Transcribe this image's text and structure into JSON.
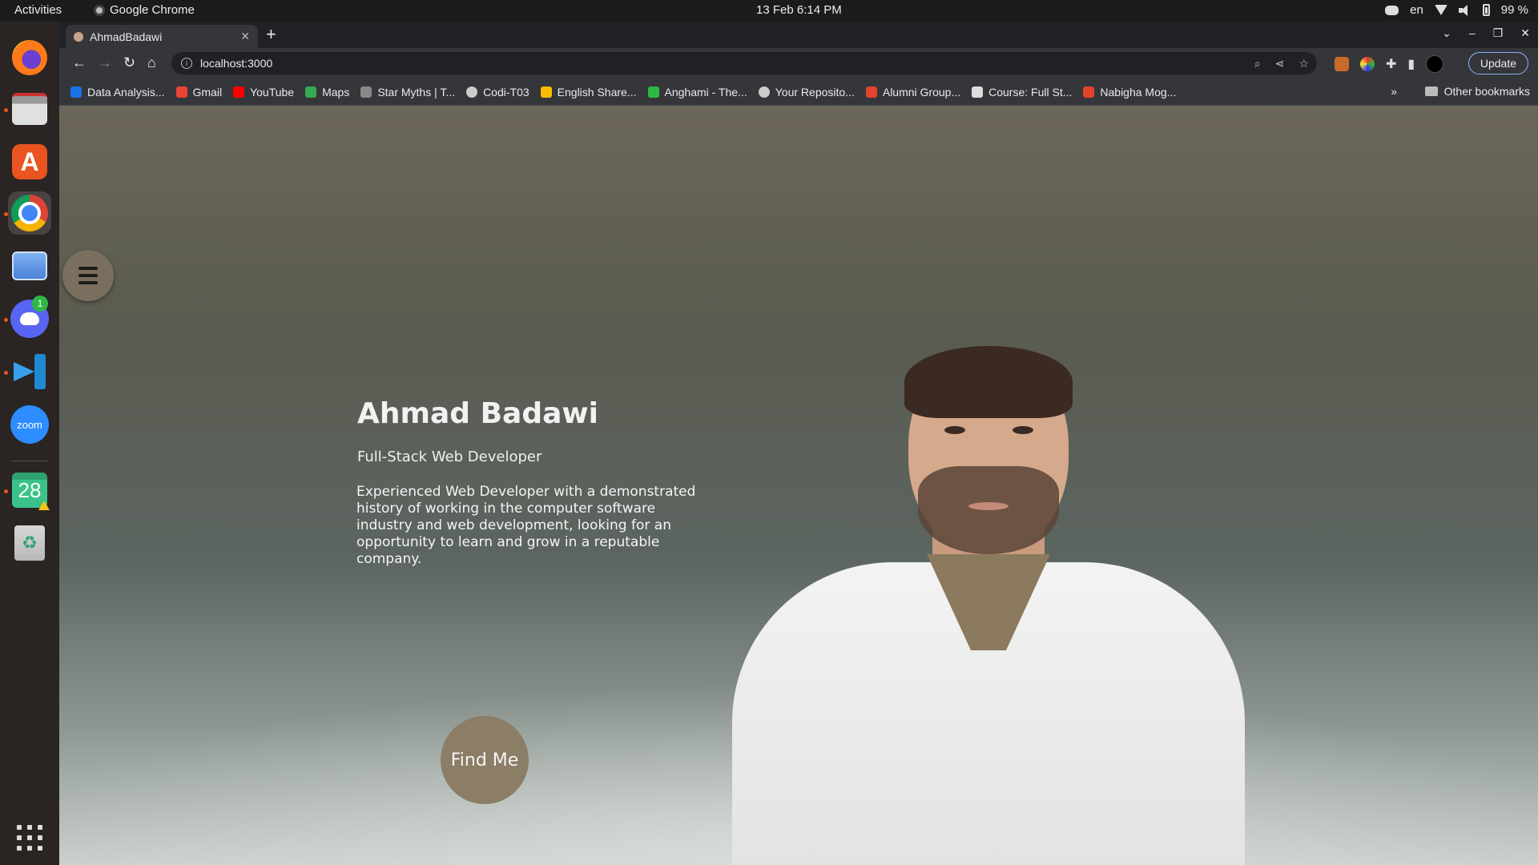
{
  "topbar": {
    "activities": "Activities",
    "app_name": "Google Chrome",
    "clock": "13 Feb  6:14 PM",
    "lang": "en",
    "battery": "99 %"
  },
  "dock": {
    "discord_badge": "1",
    "calendar_day": "28",
    "zoom_label": "zoom",
    "store_label": "A"
  },
  "browser": {
    "tab_title": "AhmadBadawi",
    "url": "localhost:3000",
    "update_label": "Update",
    "bookmarks": [
      {
        "label": "Data Analysis...",
        "color": "#1a73e8"
      },
      {
        "label": "Gmail",
        "color": "#ea4335"
      },
      {
        "label": "YouTube",
        "color": "#ff0000"
      },
      {
        "label": "Maps",
        "color": "#34a853"
      },
      {
        "label": "Star Myths | T...",
        "color": "#888888"
      },
      {
        "label": "Codi-T03",
        "color": "#cccccc"
      },
      {
        "label": "English Share...",
        "color": "#fbbc04"
      },
      {
        "label": "Anghami - The...",
        "color": "#2db843"
      },
      {
        "label": "Your Reposito...",
        "color": "#cccccc"
      },
      {
        "label": "Alumni Group...",
        "color": "#e2432a"
      },
      {
        "label": "Course: Full St...",
        "color": "#dddddd"
      },
      {
        "label": "Nabigha Mog...",
        "color": "#e2432a"
      }
    ],
    "bookmarks_more": "»",
    "other_bookmarks": "Other bookmarks"
  },
  "hero": {
    "name": "Ahmad Badawi",
    "role": "Full-Stack Web Developer",
    "description": "Experienced Web Developer with a demonstrated history of working in the computer software industry and web development, looking for an opportunity to learn and grow in a reputable company.",
    "cta": "Find Me"
  },
  "colors": {
    "accent_button": "#8b7d66",
    "menu_button": "#7a6f5e"
  }
}
